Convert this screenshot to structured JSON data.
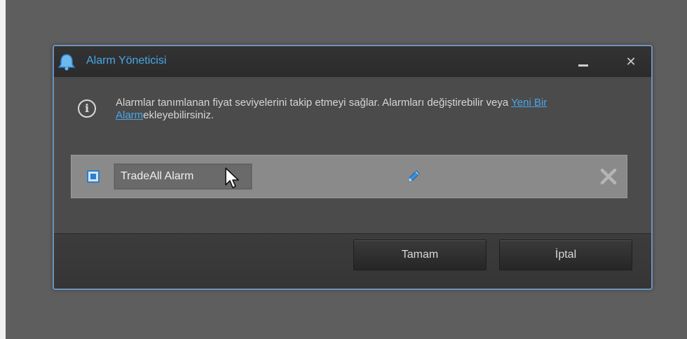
{
  "dialog": {
    "title": "Alarm Yöneticisi",
    "minimize_glyph": "_",
    "close_glyph": "✕"
  },
  "info": {
    "text_before_link": "Alarmlar tanımlanan fiyat seviyelerini takip etmeyi sağlar. Alarmları değiştirebilir veya ",
    "link_label": "Yeni Bir Alarm",
    "text_after_link": "ekleyebilirsiniz.",
    "icon_glyph": "i"
  },
  "alarms": [
    {
      "name": "TradeAll Alarm",
      "checked": true
    }
  ],
  "buttons": {
    "ok_label": "Tamam",
    "cancel_label": "İptal"
  },
  "colors": {
    "accent": "#4aa6e8",
    "background": "#5e5e5e",
    "dialog_border": "#6c94bf",
    "row_background": "#8a8a8a"
  },
  "icons": [
    "bell-icon",
    "info-icon",
    "checkbox-icon",
    "cursor-icon",
    "pencil-icon",
    "delete-icon"
  ]
}
